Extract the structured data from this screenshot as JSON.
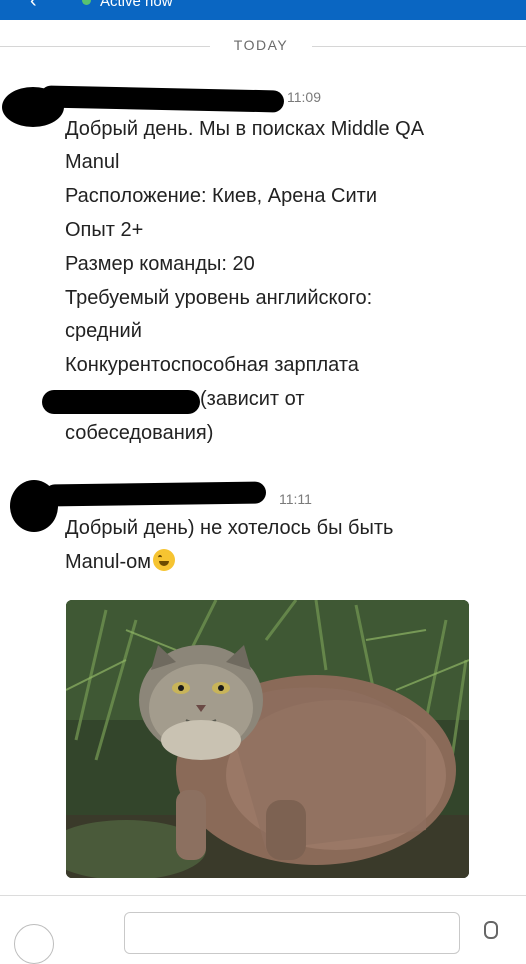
{
  "header": {
    "status": "Active now",
    "back_icon": "back-arrow-icon",
    "bar_color": "#0a66c2",
    "presence_color": "#57c270"
  },
  "conversation": {
    "day_label": "TODAY",
    "messages": [
      {
        "time": "11:09",
        "lines": [
          "Добрый день. Мы в поисках Middle QA",
          "Manul",
          "Расположение: Киев, Арена Сити",
          "Опыт 2+",
          "Размер команды: 20",
          "Требуемый уровень английского:",
          "средний",
          "Конкурентоспособная зарплата",
          "(зависит от",
          "собеседования)"
        ]
      },
      {
        "time": "11:11",
        "lines": [
          "Добрый день) не хотелось бы быть",
          "Manul-ом"
        ],
        "emoji": "rolling-on-floor-laughing-emoji",
        "attachment": "pallas-cat-photo"
      }
    ]
  },
  "composer": {
    "add_icon": "plus-circle-icon",
    "mic_icon": "microphone-icon"
  }
}
